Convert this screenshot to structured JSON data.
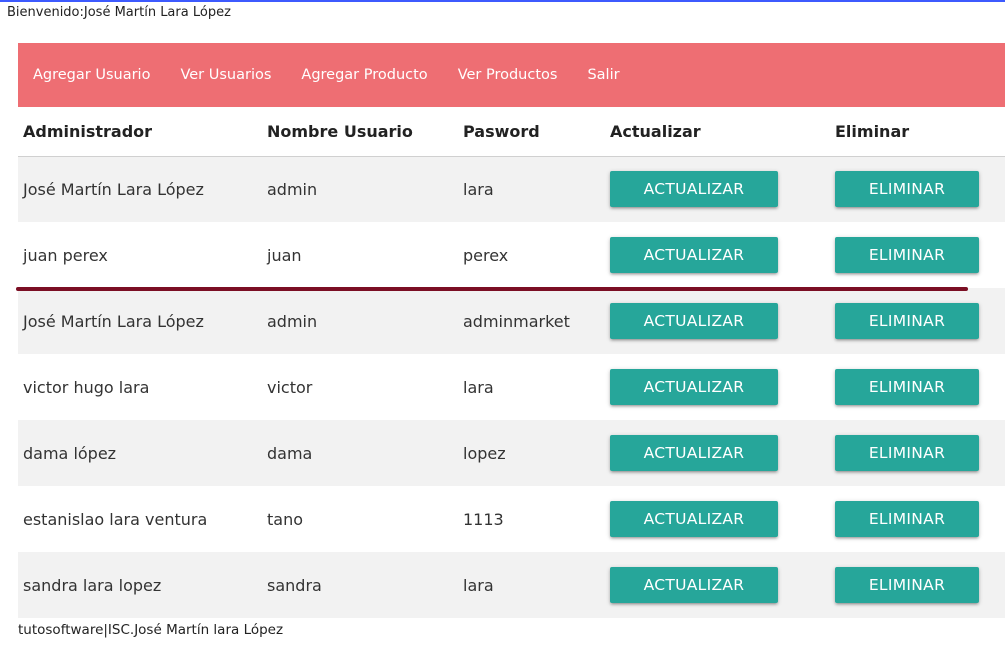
{
  "header": {
    "welcome": "Bienvenido:José Martín Lara López"
  },
  "nav": {
    "items": [
      "Agregar Usuario",
      "Ver Usuarios",
      "Agregar Producto",
      "Ver Productos",
      "Salir"
    ]
  },
  "table": {
    "headers": [
      "Administrador",
      "Nombre Usuario",
      "Pasword",
      "Actualizar",
      "Eliminar"
    ],
    "rows": [
      [
        "José Martín Lara López",
        "admin",
        "lara"
      ],
      [
        "juan perex",
        "juan",
        "perex"
      ],
      [
        "José Martín Lara López",
        "admin",
        "adminmarket"
      ],
      [
        "victor hugo lara",
        "victor",
        "lara"
      ],
      [
        "dama lópez",
        "dama",
        "lopez"
      ],
      [
        "estanislao lara ventura",
        "tano",
        "1113"
      ],
      [
        "sandra lara lopez",
        "sandra",
        "lara"
      ]
    ],
    "update_label": "ACTUALIZAR",
    "delete_label": "ELIMINAR"
  },
  "colors": {
    "nav": "#ee6e73",
    "button": "#26a69a",
    "divider": "#7b0f24"
  },
  "footer": {
    "text": "tutosoftware|ISC.José Martín lara López"
  }
}
